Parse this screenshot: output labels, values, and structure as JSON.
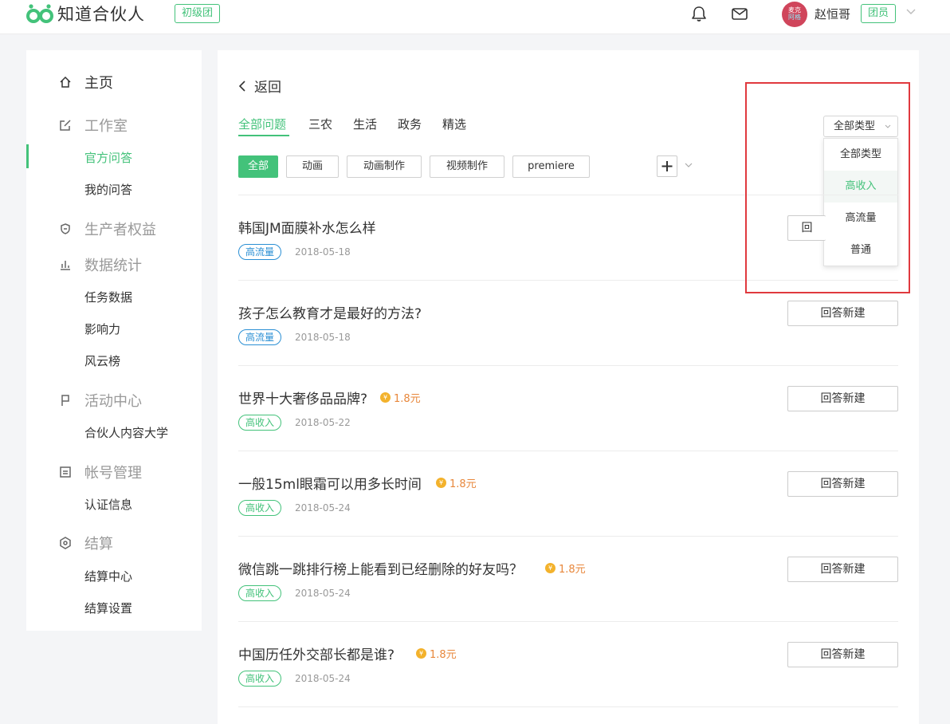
{
  "header": {
    "logo_text": "知道合伙人",
    "level_badge": "初级团",
    "avatar_text_top": "麦克",
    "avatar_text_bottom": "阿格",
    "username": "赵恒哥",
    "role_badge": "团员",
    "brand_color": "#43c27a"
  },
  "sidebar": {
    "home": "主页",
    "studio": "工作室",
    "official_qa": "官方问答",
    "my_answers": "我的问答",
    "producer_rights": "生产者权益",
    "data_stats": "数据统计",
    "task_data": "任务数据",
    "influence": "影响力",
    "leaderboard": "风云榜",
    "events": "活动中心",
    "partner_university": "合伙人内容大学",
    "account": "帐号管理",
    "certification": "认证信息",
    "settlement": "结算",
    "settlement_center": "结算中心",
    "settlement_settings": "结算设置"
  },
  "main": {
    "back_label": "返回",
    "tabs": [
      "全部问题",
      "三农",
      "生活",
      "政务",
      "精选"
    ],
    "chips": [
      "全部",
      "动画",
      "动画制作",
      "视频制作",
      "premiere"
    ],
    "type_select": "全部类型",
    "type_options": [
      "全部类型",
      "高收入",
      "高流量",
      "普通"
    ],
    "answer_label": "回答新建",
    "questions": [
      {
        "title": "韩国JM面膜补水怎么样",
        "tag": "高流量",
        "date": "2018-05-18",
        "reward": ""
      },
      {
        "title": "孩子怎么教育才是最好的方法?",
        "tag": "高流量",
        "date": "2018-05-18",
        "reward": ""
      },
      {
        "title": "世界十大奢侈品品牌?",
        "tag": "高收入",
        "date": "2018-05-22",
        "reward": "1.8元"
      },
      {
        "title": "一般15ml眼霜可以用多长时间",
        "tag": "高收入",
        "date": "2018-05-24",
        "reward": "1.8元"
      },
      {
        "title": "微信跳一跳排行榜上能看到已经删除的好友吗？",
        "tag": "高收入",
        "date": "2018-05-24",
        "reward": "1.8元"
      },
      {
        "title": "中国历任外交部长都是谁?",
        "tag": "高收入",
        "date": "2018-05-24",
        "reward": "1.8元"
      }
    ],
    "coin_symbol": "¥",
    "partial_button_text": "回"
  }
}
